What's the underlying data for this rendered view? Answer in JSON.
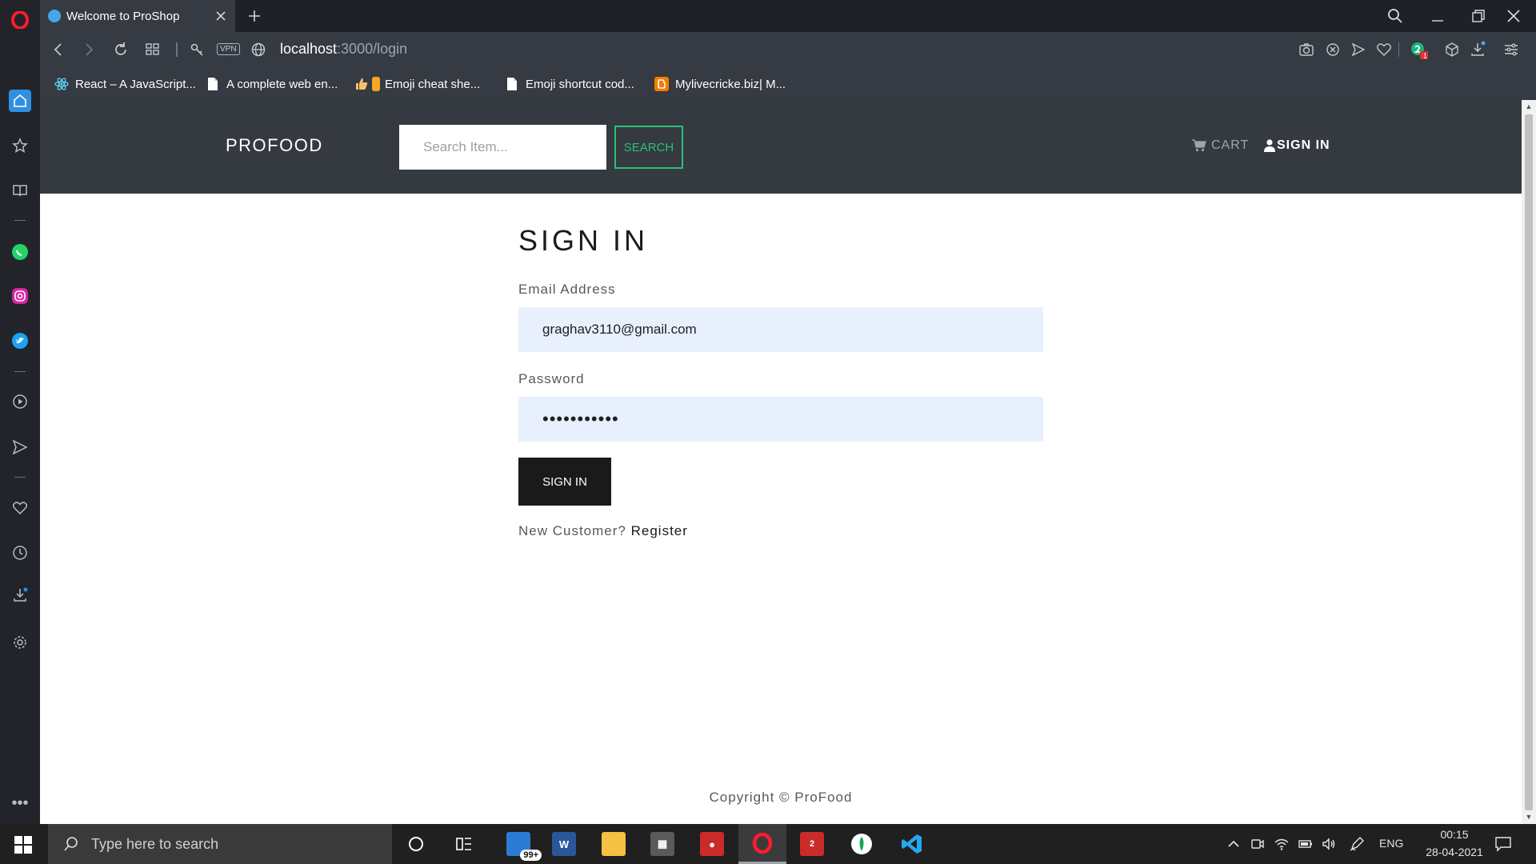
{
  "browser": {
    "tab_title": "Welcome to ProShop",
    "url_host": "localhost",
    "url_path": ":3000/login",
    "vpn_label": "VPN",
    "bookmarks": [
      {
        "label": "React – A JavaScript...",
        "icon": "react-icon",
        "color": "#61dafb"
      },
      {
        "label": "A complete web en...",
        "icon": "page-icon",
        "color": "#ffffff"
      },
      {
        "label": "Emoji cheat she...",
        "icon": "emoji-icon",
        "color": "#f5a623"
      },
      {
        "label": "Emoji shortcut cod...",
        "icon": "page-icon",
        "color": "#ffffff"
      },
      {
        "label": "Mylivecricke.biz| M...",
        "icon": "blogger-icon",
        "color": "#f57d00"
      }
    ],
    "extension_badge": "1"
  },
  "navbar": {
    "brand": "PROFOOD",
    "search_placeholder": "Search Item...",
    "search_button": "SEARCH",
    "cart_label": "CART",
    "signin_label": "SIGN IN"
  },
  "form": {
    "title": "SIGN IN",
    "email_label": "Email Address",
    "email_value": "graghav3110@gmail.com",
    "password_label": "Password",
    "password_value": "•••••••••••",
    "submit_label": "SIGN IN",
    "new_customer_text": "New Customer?",
    "register_label": "Register"
  },
  "footer": {
    "copyright": "Copyright © ProFood"
  },
  "taskbar": {
    "search_placeholder": "Type here to search",
    "mail_badge": "99+",
    "language": "ENG",
    "time": "00:15",
    "date": "28-04-2021"
  },
  "colors": {
    "navbar_bg": "#343a40",
    "search_accent": "#2dbe7a",
    "input_autofill": "#e8f0fe",
    "button_dark": "#1a1a1a"
  }
}
